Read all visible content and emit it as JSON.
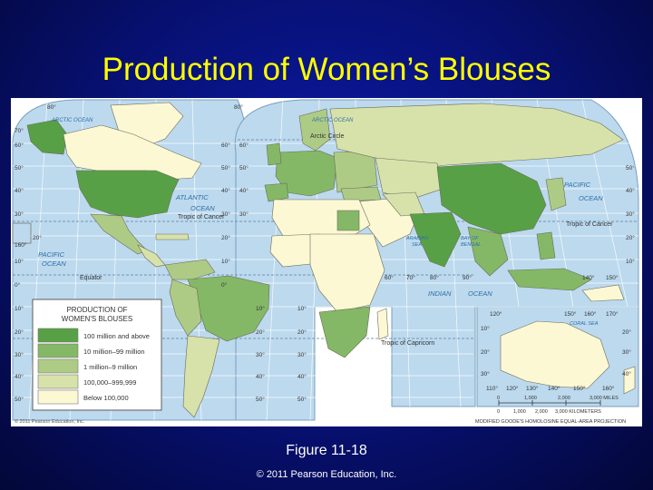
{
  "slide": {
    "title": "Production of Women’s Blouses",
    "figure_caption": "Figure 11-18",
    "copyright": "© 2011 Pearson Education, Inc."
  },
  "colors": {
    "background": "#071070",
    "title": "#ffff00",
    "ocean": "#bcd9ee",
    "class_1": "#58a046",
    "class_2": "#84b866",
    "class_3": "#aecb86",
    "class_4": "#d7e2aa",
    "class_5": "#fcf8d4"
  },
  "map": {
    "legend": {
      "title_line1": "PRODUCTION OF",
      "title_line2": "WOMEN'S BLOUSES",
      "classes": [
        {
          "label": "100 million and above",
          "color": "#58a046"
        },
        {
          "label": "10 million–99 million",
          "color": "#84b866"
        },
        {
          "label": "1 million–9 million",
          "color": "#aecb86"
        },
        {
          "label": "100,000–999,999",
          "color": "#d7e2aa"
        },
        {
          "label": "Below 100,000",
          "color": "#fcf8d4"
        }
      ]
    },
    "ocean_labels": {
      "arctic_west": "ARCTIC OCEAN",
      "arctic_east": "ARCTIC OCEAN",
      "atlantic_1": "ATLANTIC",
      "atlantic_2": "OCEAN",
      "pacific_w1": "PACIFIC",
      "pacific_w2": "OCEAN",
      "pacific_e1": "PACIFIC",
      "pacific_e2": "OCEAN",
      "indian": "INDIAN",
      "indian_ocean": "OCEAN",
      "arabian_1": "ARABIAN",
      "arabian_2": "SEA",
      "bengal_1": "BAY OF",
      "bengal_2": "BENGAL",
      "coral_sea": "CORAL SEA"
    },
    "line_labels": {
      "arctic_circle": "Arctic Circle",
      "tropic_cancer_w": "Tropic of Cancer",
      "tropic_cancer_e": "Tropic of Cancer",
      "equator": "Equator",
      "tropic_capricorn": "Tropic of Capricorn"
    },
    "degree_labels": {
      "left_lat": [
        "70°",
        "60°",
        "50°",
        "40°",
        "30°",
        "20°",
        "10°",
        "0°",
        "10°",
        "20°",
        "30°",
        "40°",
        "50°"
      ],
      "mid_left_lat": [
        "60°",
        "50°",
        "40°",
        "30°",
        "20°",
        "10°",
        "0°",
        "10°",
        "20°",
        "30°",
        "40°",
        "50°"
      ],
      "mid_right_lat": [
        "60°",
        "50°",
        "40°",
        "30°"
      ],
      "right_lat": [
        "50°",
        "40°",
        "30°",
        "20°",
        "10°"
      ],
      "aus_lat_left": [
        "10°",
        "20°",
        "30°"
      ],
      "aus_lat_right": [
        "20°",
        "30°",
        "40°"
      ],
      "top_lon": [
        "80°",
        "80°"
      ],
      "inset_left": "160°",
      "india_lon": [
        "60°",
        "70°",
        "80°",
        "90°"
      ],
      "indo_lon": [
        "140°",
        "150°"
      ],
      "aus_top_lon": [
        "120°",
        "150°",
        "160°",
        "170°"
      ],
      "aus_bottom_lon": [
        "110°",
        "120°",
        "130°",
        "140°",
        "150°",
        "160°"
      ],
      "africa_lat": [
        "10°",
        "20°",
        "30°",
        "40°",
        "50°"
      ]
    },
    "scale": {
      "miles_ticks": [
        "0",
        "1,000",
        "2,000",
        "3,000 MILES"
      ],
      "km_ticks": [
        "0",
        "1,000",
        "2,000",
        "3,000 KILOMETERS"
      ]
    },
    "projection": "MODIFIED GOODE'S HOMOLOSINE EQUAL-AREA PROJECTION",
    "credit": "© 2011 Pearson Education, Inc."
  }
}
